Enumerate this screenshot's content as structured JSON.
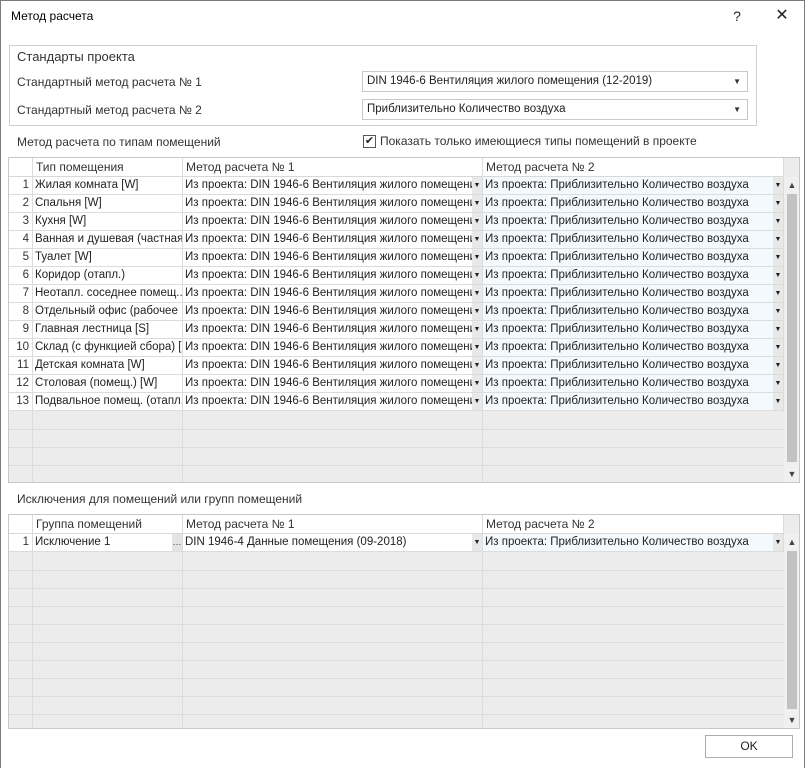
{
  "window": {
    "title": "Метод расчета",
    "help_label": "?",
    "close_label": "✕"
  },
  "standards": {
    "title": "Стандарты проекта",
    "method1_label": "Стандартный метод расчета № 1",
    "method1_value": "DIN 1946-6 Вентиляция жилого помещения (12-2019)",
    "method2_label": "Стандартный метод расчета № 2",
    "method2_value": "Приблизительно Количество воздуха"
  },
  "room_types": {
    "section_label": "Метод расчета по типам помещений",
    "show_only_checkbox": {
      "label": "Показать только имеющиеся типы помещений в проекте",
      "checked": true
    },
    "columns": [
      "Тип помещения",
      "Метод расчета № 1",
      "Метод расчета № 2"
    ],
    "rows": [
      {
        "n": "1",
        "name": "Жилая комната [W]",
        "m1": "Из проекта: DIN 1946-6 Вентиляция жилого помещени",
        "m2": "Из проекта: Приблизительно Количество воздуха"
      },
      {
        "n": "2",
        "name": "Спальня [W]",
        "m1": "Из проекта: DIN 1946-6 Вентиляция жилого помещени",
        "m2": "Из проекта: Приблизительно Количество воздуха"
      },
      {
        "n": "3",
        "name": "Кухня [W]",
        "m1": "Из проекта: DIN 1946-6 Вентиляция жилого помещени",
        "m2": "Из проекта: Приблизительно Количество воздуха"
      },
      {
        "n": "4",
        "name": "Ванная и душевая (частная...",
        "m1": "Из проекта: DIN 1946-6 Вентиляция жилого помещени",
        "m2": "Из проекта: Приблизительно Количество воздуха"
      },
      {
        "n": "5",
        "name": "Туалет [W]",
        "m1": "Из проекта: DIN 1946-6 Вентиляция жилого помещени",
        "m2": "Из проекта: Приблизительно Количество воздуха"
      },
      {
        "n": "6",
        "name": "Коридор (отапл.)",
        "m1": "Из проекта: DIN 1946-6 Вентиляция жилого помещени",
        "m2": "Из проекта: Приблизительно Количество воздуха"
      },
      {
        "n": "7",
        "name": "Неотапл. соседнее помещ...",
        "m1": "Из проекта: DIN 1946-6 Вентиляция жилого помещени",
        "m2": "Из проекта: Приблизительно Количество воздуха"
      },
      {
        "n": "8",
        "name": "Отдельный офис (рабочее ...",
        "m1": "Из проекта: DIN 1946-6 Вентиляция жилого помещени",
        "m2": "Из проекта: Приблизительно Количество воздуха"
      },
      {
        "n": "9",
        "name": "Главная лестница [S]",
        "m1": "Из проекта: DIN 1946-6 Вентиляция жилого помещени",
        "m2": "Из проекта: Приблизительно Количество воздуха"
      },
      {
        "n": "10",
        "name": "Склад (с функцией сбора) [S]",
        "m1": "Из проекта: DIN 1946-6 Вентиляция жилого помещени",
        "m2": "Из проекта: Приблизительно Количество воздуха"
      },
      {
        "n": "11",
        "name": "Детская комната [W]",
        "m1": "Из проекта: DIN 1946-6 Вентиляция жилого помещени",
        "m2": "Из проекта: Приблизительно Количество воздуха"
      },
      {
        "n": "12",
        "name": "Столовая (помещ.) [W]",
        "m1": "Из проекта: DIN 1946-6 Вентиляция жилого помещени",
        "m2": "Из проекта: Приблизительно Количество воздуха"
      },
      {
        "n": "13",
        "name": "Подвальное помещ. (отапл...",
        "m1": "Из проекта: DIN 1946-6 Вентиляция жилого помещени",
        "m2": "Из проекта: Приблизительно Количество воздуха"
      }
    ]
  },
  "exceptions": {
    "section_label": "Исключения для помещений или групп помещений",
    "columns": [
      "Группа помещений",
      "Метод расчета № 1",
      "Метод расчета № 2"
    ],
    "rows": [
      {
        "n": "1",
        "name": "Исключение 1",
        "m1": "DIN 1946-4 Данные помещения (09-2018)",
        "m2": "Из проекта: Приблизительно Количество воздуха"
      }
    ]
  },
  "ok_label": "OK",
  "icons": {
    "dropdown": "▼",
    "scroll_up": "▲",
    "scroll_down": "▼",
    "checkmark": "✔",
    "ellipsis": "…"
  }
}
